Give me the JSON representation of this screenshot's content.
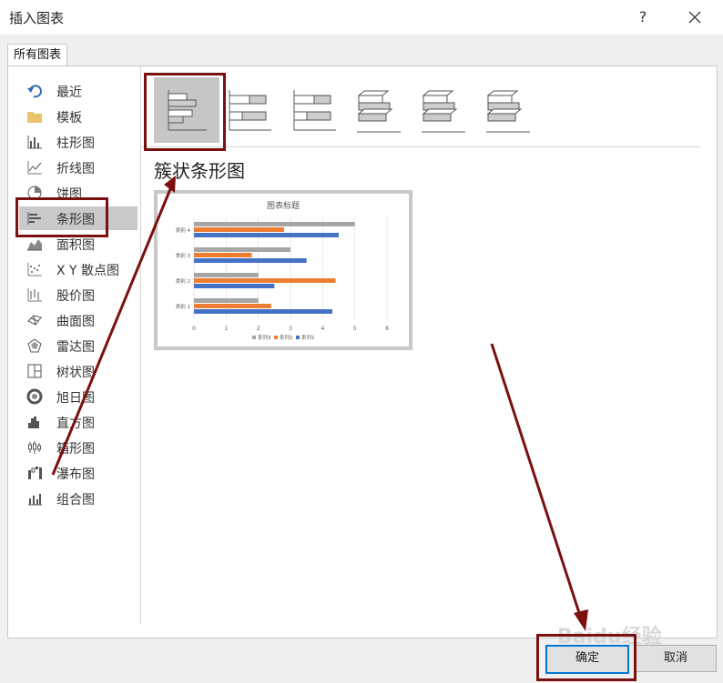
{
  "window": {
    "title": "插入图表",
    "help_label": "?"
  },
  "tabs": [
    {
      "label": "所有图表"
    }
  ],
  "categories": [
    {
      "label": "最近",
      "icon": "undo-icon"
    },
    {
      "label": "模板",
      "icon": "folder-icon"
    },
    {
      "label": "柱形图",
      "icon": "column-chart-icon"
    },
    {
      "label": "折线图",
      "icon": "line-chart-icon"
    },
    {
      "label": "饼图",
      "icon": "pie-chart-icon"
    },
    {
      "label": "条形图",
      "icon": "bar-chart-icon",
      "selected": true
    },
    {
      "label": "面积图",
      "icon": "area-chart-icon"
    },
    {
      "label": "X Y 散点图",
      "icon": "scatter-chart-icon"
    },
    {
      "label": "股价图",
      "icon": "stock-chart-icon"
    },
    {
      "label": "曲面图",
      "icon": "surface-chart-icon"
    },
    {
      "label": "雷达图",
      "icon": "radar-chart-icon"
    },
    {
      "label": "树状图",
      "icon": "treemap-chart-icon"
    },
    {
      "label": "旭日图",
      "icon": "sunburst-chart-icon"
    },
    {
      "label": "直方图",
      "icon": "histogram-chart-icon"
    },
    {
      "label": "箱形图",
      "icon": "boxplot-chart-icon"
    },
    {
      "label": "瀑布图",
      "icon": "waterfall-chart-icon"
    },
    {
      "label": "组合图",
      "icon": "combo-chart-icon"
    }
  ],
  "subtypes": [
    {
      "icon": "clustered-bar-icon",
      "selected": true
    },
    {
      "icon": "stacked-bar-icon"
    },
    {
      "icon": "100-stacked-bar-icon"
    },
    {
      "icon": "3d-clustered-bar-icon"
    },
    {
      "icon": "3d-stacked-bar-icon"
    },
    {
      "icon": "3d-100-stacked-bar-icon"
    }
  ],
  "selected_type_title": "簇状条形图",
  "preview": {
    "chart_data": {
      "type": "bar",
      "title": "图表标题",
      "categories": [
        "类别 1",
        "类别 2",
        "类别 3",
        "类别 4"
      ],
      "series": [
        {
          "name": "系列1",
          "values": [
            4.3,
            2.5,
            3.5,
            4.5
          ],
          "color": "#4472c4"
        },
        {
          "name": "系列2",
          "values": [
            2.4,
            4.4,
            1.8,
            2.8
          ],
          "color": "#ed7d31"
        },
        {
          "name": "系列3",
          "values": [
            2,
            2,
            3,
            5
          ],
          "color": "#a5a5a5"
        }
      ],
      "xlim": [
        0,
        6
      ],
      "x_ticks": [
        "0",
        "1",
        "2",
        "3",
        "4",
        "5",
        "6"
      ],
      "legend_order": [
        "系列3",
        "系列2",
        "系列1"
      ],
      "grid": true,
      "legend": "bottom"
    }
  },
  "buttons": {
    "ok": "确定",
    "cancel": "取消"
  },
  "watermark": "Baidu经验",
  "annotation_color": "#7a1010"
}
